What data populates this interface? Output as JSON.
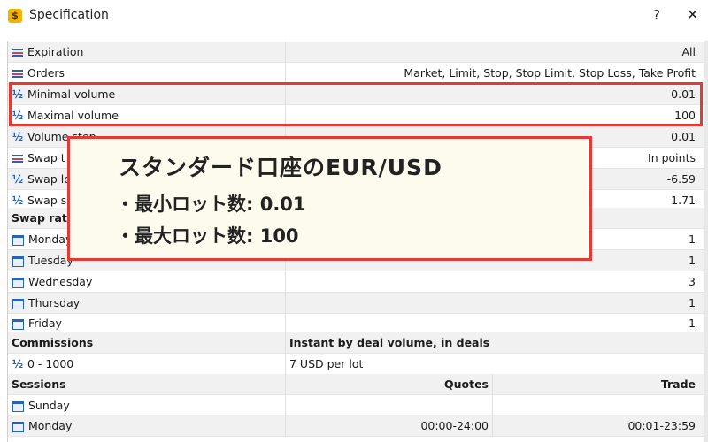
{
  "window": {
    "title": "Specification",
    "help": "?",
    "close": "✕",
    "app_icon": "$"
  },
  "rows": {
    "expiration": {
      "label": "Expiration",
      "value": "All"
    },
    "orders": {
      "label": "Orders",
      "value": "Market, Limit, Stop, Stop Limit, Stop Loss, Take Profit"
    },
    "min_volume": {
      "label": "Minimal volume",
      "value": "0.01"
    },
    "max_volume": {
      "label": "Maximal volume",
      "value": "100"
    },
    "volume_step": {
      "label": "Volume step",
      "value": "0.01"
    },
    "swap_type": {
      "label": "Swap t",
      "value": "In points"
    },
    "swap_long": {
      "label": "Swap lo",
      "value": "-6.59"
    },
    "swap_short": {
      "label": "Swap s",
      "value": "1.71"
    },
    "swap_rates": {
      "label": "Swap rat"
    },
    "monday": {
      "label": "Monday",
      "value": "1"
    },
    "tuesday": {
      "label": "Tuesday",
      "value": "1"
    },
    "wednesday": {
      "label": "Wednesday",
      "value": "3"
    },
    "thursday": {
      "label": "Thursday",
      "value": "1"
    },
    "friday": {
      "label": "Friday",
      "value": "1"
    },
    "commissions": {
      "label": "Commissions",
      "header": "Instant by deal volume, in deals"
    },
    "commission_range": {
      "label": "0 - 1000",
      "value": "7 USD per lot"
    },
    "sessions": {
      "label": "Sessions",
      "quotes": "Quotes",
      "trade": "Trade"
    },
    "sunday": {
      "label": "Sunday"
    },
    "session_monday": {
      "label": "Monday",
      "quotes": "00:00-24:00",
      "trade": "00:01-23:59"
    }
  },
  "callout": {
    "title": "スタンダード口座のEUR/USD",
    "line1": "・最小ロット数: 0.01",
    "line2": "・最大ロット数: 100"
  },
  "icons": {
    "half": "½"
  },
  "colors": {
    "highlight": "#e53935",
    "icon": "#2a62b5",
    "callout_bg": "#fdfbee"
  }
}
